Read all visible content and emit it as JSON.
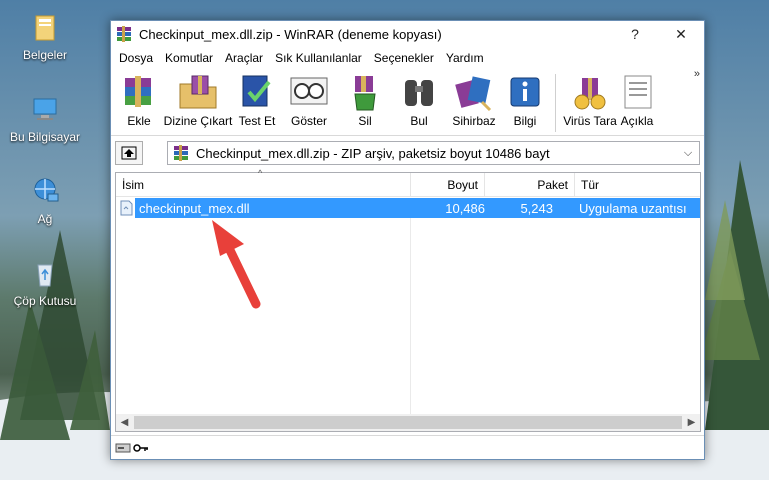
{
  "desktop": {
    "icons": [
      {
        "label": "Belgeler",
        "icon": "folder-icon"
      },
      {
        "label": "Bu Bilgisayar",
        "icon": "computer-icon"
      },
      {
        "label": "Ağ",
        "icon": "network-icon"
      },
      {
        "label": "Çöp Kutusu",
        "icon": "recycle-bin-icon"
      }
    ]
  },
  "window": {
    "title": "Checkinput_mex.dll.zip - WinRAR (deneme kopyası)",
    "help_button": "?",
    "close_button": "✕"
  },
  "menu": [
    "Dosya",
    "Komutlar",
    "Araçlar",
    "Sık Kullanılanlar",
    "Seçenekler",
    "Yardım"
  ],
  "toolbar": {
    "buttons": [
      {
        "label": "Ekle",
        "icon": "add-archive-icon"
      },
      {
        "label": "Dizine Çıkart",
        "icon": "extract-to-icon"
      },
      {
        "label": "Test Et",
        "icon": "test-icon"
      },
      {
        "label": "Göster",
        "icon": "view-icon"
      },
      {
        "label": "Sil",
        "icon": "delete-icon"
      },
      {
        "label": "Bul",
        "icon": "find-icon"
      },
      {
        "label": "Sihirbaz",
        "icon": "wizard-icon"
      },
      {
        "label": "Bilgi",
        "icon": "info-icon"
      },
      {
        "label": "Virüs Tara",
        "icon": "virus-scan-icon"
      },
      {
        "label": "Açıkla",
        "icon": "comment-icon"
      }
    ],
    "overflow": "»"
  },
  "address": {
    "text": "Checkinput_mex.dll.zip - ZIP arşiv, paketsiz boyut 10486 bayt",
    "dropdown": "⌵"
  },
  "columns": {
    "name": "İsim",
    "size": "Boyut",
    "packed": "Paket",
    "type": "Tür"
  },
  "files": [
    {
      "name": "checkinput_mex.dll",
      "size": "10,486",
      "packed": "5,243",
      "type": "Uygulama uzantısı"
    }
  ],
  "colors": {
    "selection": "#3399ff",
    "arrow": "#e8403a"
  }
}
